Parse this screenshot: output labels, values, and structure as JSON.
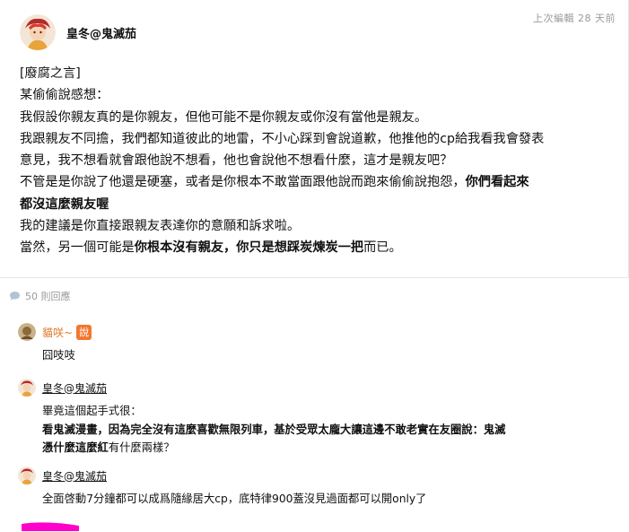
{
  "post": {
    "edited_label": "上次編輯  28 天前",
    "author": "皇冬@鬼滅茄",
    "body": {
      "p1": "[廢腐之言]",
      "p2": "某偷偷說感想：",
      "p3": "我假設你親友真的是你親友，但他可能不是你親友或你沒有當他是親友。",
      "p4": "我跟親友不同擔，我們都知道彼此的地雷，不小心踩到會說道歉，他推他的cp給我看我會發表",
      "p5": "意見，我不想看就會跟他說不想看，他也會說他不想看什麼，這才是親友吧？",
      "p6_normal": "不管是是你說了他還是硬塞，或者是你根本不敢當面跟他說而跑來偷偷說抱怨，",
      "p6_bold": "你們看起來",
      "p7_bold": "都沒這麼親友喔",
      "p8": "我的建議是你直接跟親友表達你的意願和訴求啦。",
      "p9_a": "當然，另一個可能是",
      "p9_bold": "你根本沒有親友，你只是想踩炭煉炭一把",
      "p9_b": "而已。"
    }
  },
  "replies": {
    "count_label": "50 則回應"
  },
  "comments": [
    {
      "name": "貓咲~",
      "badge": "說",
      "lines": [
        "囧吱吱"
      ]
    },
    {
      "name": "皇冬@鬼滅茄",
      "line1": "畢竟這個起手式很：",
      "line2_bold": "看鬼滅漫畫，因為完全沒有這麼喜歡無限列車，基於受眾太龐大讓這邊不敢老實在友圈說：鬼滅",
      "line3_bold": "憑什麼這麼紅",
      "line3_normal": "有什麼兩樣？"
    },
    {
      "name": "皇冬@鬼滅茄",
      "lines": [
        "全面啓動7分鐘都可以成爲隨緣居大cp，底特律900蓋沒見過面都可以開only了"
      ]
    }
  ],
  "colors": {
    "badge": "#f2772f",
    "meta": "#9a9a9a",
    "pink": "#ff00cc"
  },
  "icons": {
    "reply": "speech-bubble-icon"
  }
}
